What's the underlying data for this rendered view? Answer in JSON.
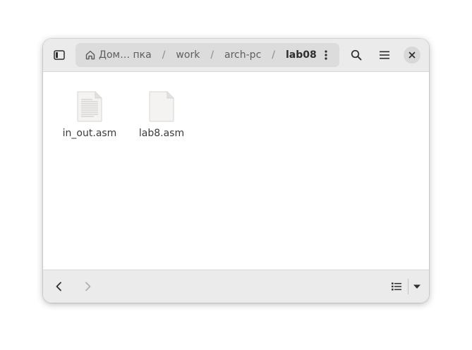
{
  "window": {
    "pathbar": {
      "crumbs": [
        {
          "label": "Дом… пка",
          "icon": "home-icon"
        },
        {
          "label": "work"
        },
        {
          "label": "arch-pc"
        },
        {
          "label": "lab08",
          "current": true
        }
      ],
      "separator": "/"
    },
    "header_icons": {
      "sidebar": "sidebar-toggle-icon",
      "path_more": "vertical-ellipsis-icon",
      "search": "search-icon",
      "menu": "hamburger-menu-icon",
      "close": "close-icon"
    },
    "files": [
      {
        "name": "in_out.asm",
        "icon": "text-file-icon"
      },
      {
        "name": "lab8.asm",
        "icon": "blank-file-icon"
      }
    ],
    "bottom_icons": {
      "back": "chevron-left-icon",
      "forward": "chevron-right-icon",
      "view": "list-view-icon",
      "view_options": "dropdown-arrow-icon"
    }
  },
  "colors": {
    "headerbar": "#ebebeb",
    "pathbar": "#dcdcdc",
    "close_button": "#d8d8d8",
    "text": "#3a3a3a"
  }
}
